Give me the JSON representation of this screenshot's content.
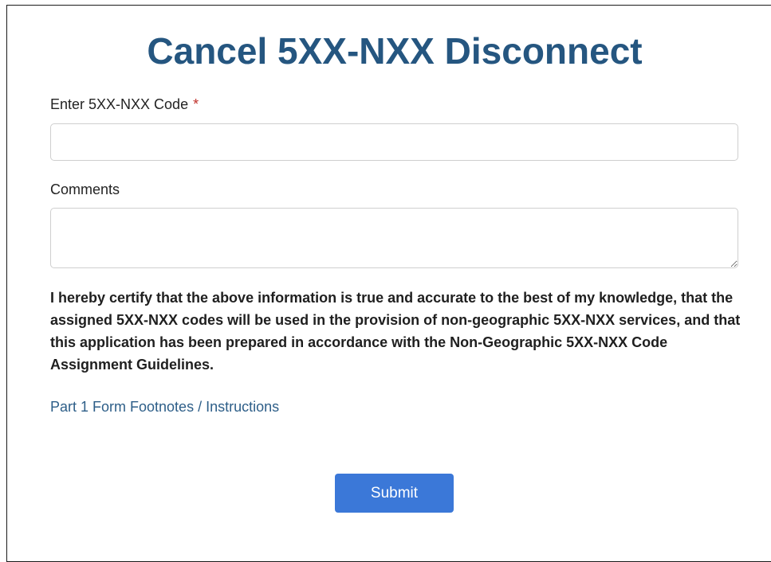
{
  "page": {
    "title": "Cancel 5XX-NXX Disconnect"
  },
  "form": {
    "code_label": "Enter 5XX-NXX Code",
    "required_mark": "*",
    "code_value": "",
    "comments_label": "Comments",
    "comments_value": "",
    "certification_text": "I hereby certify that the above information is true and accurate to the best of my knowledge, that the assigned 5XX-NXX codes will be used in the provision of non-geographic 5XX-NXX services, and that this application has been prepared in accordance with the Non-Geographic 5XX-NXX Code Assignment Guidelines.",
    "footnotes_link": "Part 1 Form Footnotes / Instructions",
    "submit_label": "Submit"
  },
  "colors": {
    "title": "#255680",
    "required": "#c0302a",
    "link": "#2d5e88",
    "button": "#3b78d8"
  }
}
